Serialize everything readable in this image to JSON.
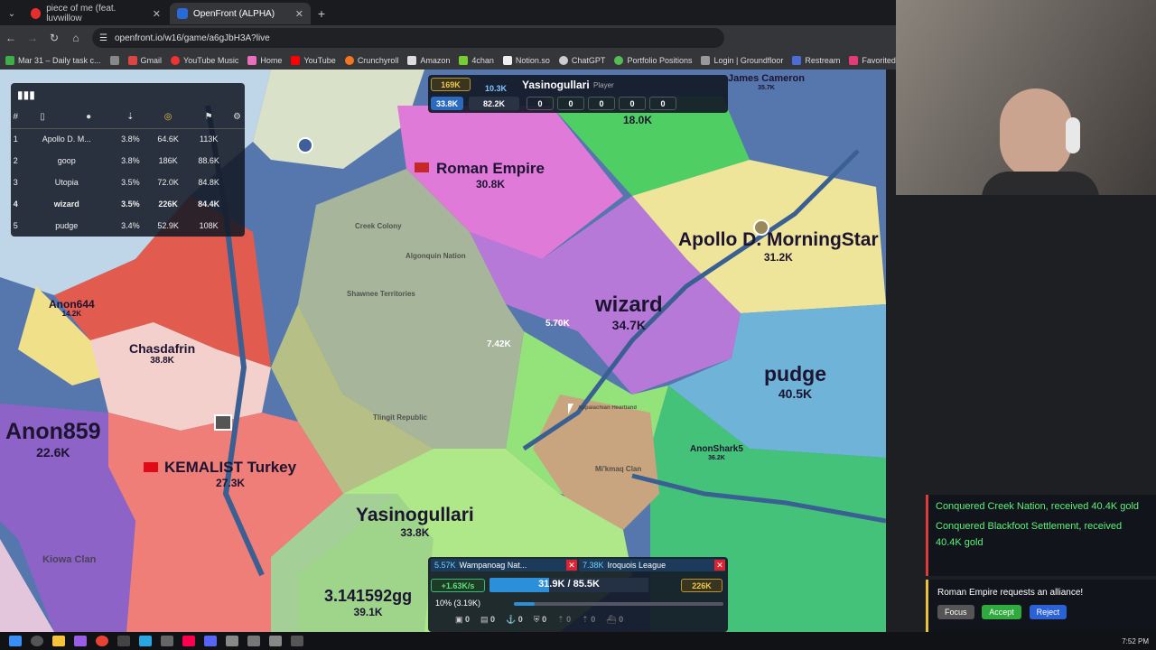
{
  "browser": {
    "tabs": [
      {
        "title": "piece of me (feat. luvwillow"
      },
      {
        "title": "OpenFront (ALPHA)"
      }
    ],
    "url": "openfront.io/w16/game/a6gJbH3A?live",
    "bookmarks": [
      "Mar 31 – Daily task c...",
      "Gmail",
      "YouTube Music",
      "Home",
      "YouTube",
      "Crunchyroll",
      "Amazon",
      "4chan",
      "Notion.so",
      "ChatGPT",
      "Portfolio Positions",
      "Login | Groundfloor",
      "Restream",
      "Favorited Studio"
    ]
  },
  "leaderboard": {
    "headers": [
      "#",
      "",
      "",
      "",
      "",
      "",
      ""
    ],
    "rows": [
      {
        "rank": "1",
        "name": "Apollo D. M...",
        "pct": "3.8%",
        "gold": "64.6K",
        "troops": "113K"
      },
      {
        "rank": "2",
        "name": "goop",
        "pct": "3.8%",
        "gold": "186K",
        "troops": "88.6K"
      },
      {
        "rank": "3",
        "name": "Utopia",
        "pct": "3.5%",
        "gold": "72.0K",
        "troops": "84.8K"
      },
      {
        "rank": "4",
        "name": "wizard",
        "pct": "3.5%",
        "gold": "226K",
        "troops": "84.4K"
      },
      {
        "rank": "5",
        "name": "pudge",
        "pct": "3.4%",
        "gold": "52.9K",
        "troops": "108K"
      }
    ]
  },
  "player_info": {
    "gold": "169K",
    "troops_top": "10.3K",
    "name": "Yasinogullari",
    "role": "Player",
    "troops": "33.8K",
    "max_troops": "82.2K",
    "counts": [
      "0",
      "0",
      "0",
      "0",
      "0"
    ]
  },
  "map_labels": [
    {
      "name": "Roman Empire",
      "value": "30.8K"
    },
    {
      "name": "wizard",
      "value": "34.7K"
    },
    {
      "name": "Apollo D. MorningStar",
      "value": "31.2K"
    },
    {
      "name": "pudge",
      "value": "40.5K"
    },
    {
      "name": "Yasinogullari",
      "value": "33.8K"
    },
    {
      "name": "KEMALIST Turkey",
      "value": "27.3K"
    },
    {
      "name": "Anon859",
      "value": "22.6K"
    },
    {
      "name": "Chasdafrin",
      "value": "38.8K"
    },
    {
      "name": "Anon644",
      "value": "14.2K"
    },
    {
      "name": "3.141592gg",
      "value": "39.1K"
    },
    {
      "name": "AnonShark5",
      "value": "36.2K"
    },
    {
      "name": "18.0K",
      "value": ""
    },
    {
      "name": "James Cameron",
      "value": "35.7K"
    }
  ],
  "small_labels": [
    "Creek Colony",
    "Algonquin Nation",
    "Shawnee Territories",
    "Tlingit Republic",
    "Mi'kmaq Clan",
    "Appalachian Heartland",
    "Kiowa Clan"
  ],
  "attack_labels": [
    "5.70K",
    "7.42K"
  ],
  "control_panel": {
    "attacks": [
      {
        "troops": "5.57K",
        "target": "Wampanoag Nat..."
      },
      {
        "troops": "7.38K",
        "target": "Iroquois League"
      }
    ],
    "troop_rate": "+1.63K/s",
    "troops_bar": "31.9K / 85.5K",
    "troops_fill": 0.373,
    "gold": "226K",
    "attack_ratio": "10% (3.19K)",
    "attack_slider": 0.1,
    "build_counts": [
      "0",
      "0",
      "0",
      "0",
      "0",
      "0",
      "0"
    ]
  },
  "notifications": [
    "Conquered Creek Nation, received 40.4K gold",
    "Conquered Blackfoot Settlement, received 40.4K gold"
  ],
  "alliance": {
    "message": "Roman Empire requests an alliance!",
    "focus": "Focus",
    "accept": "Accept",
    "reject": "Reject"
  },
  "taskbar": {
    "time": "7:52 PM"
  }
}
